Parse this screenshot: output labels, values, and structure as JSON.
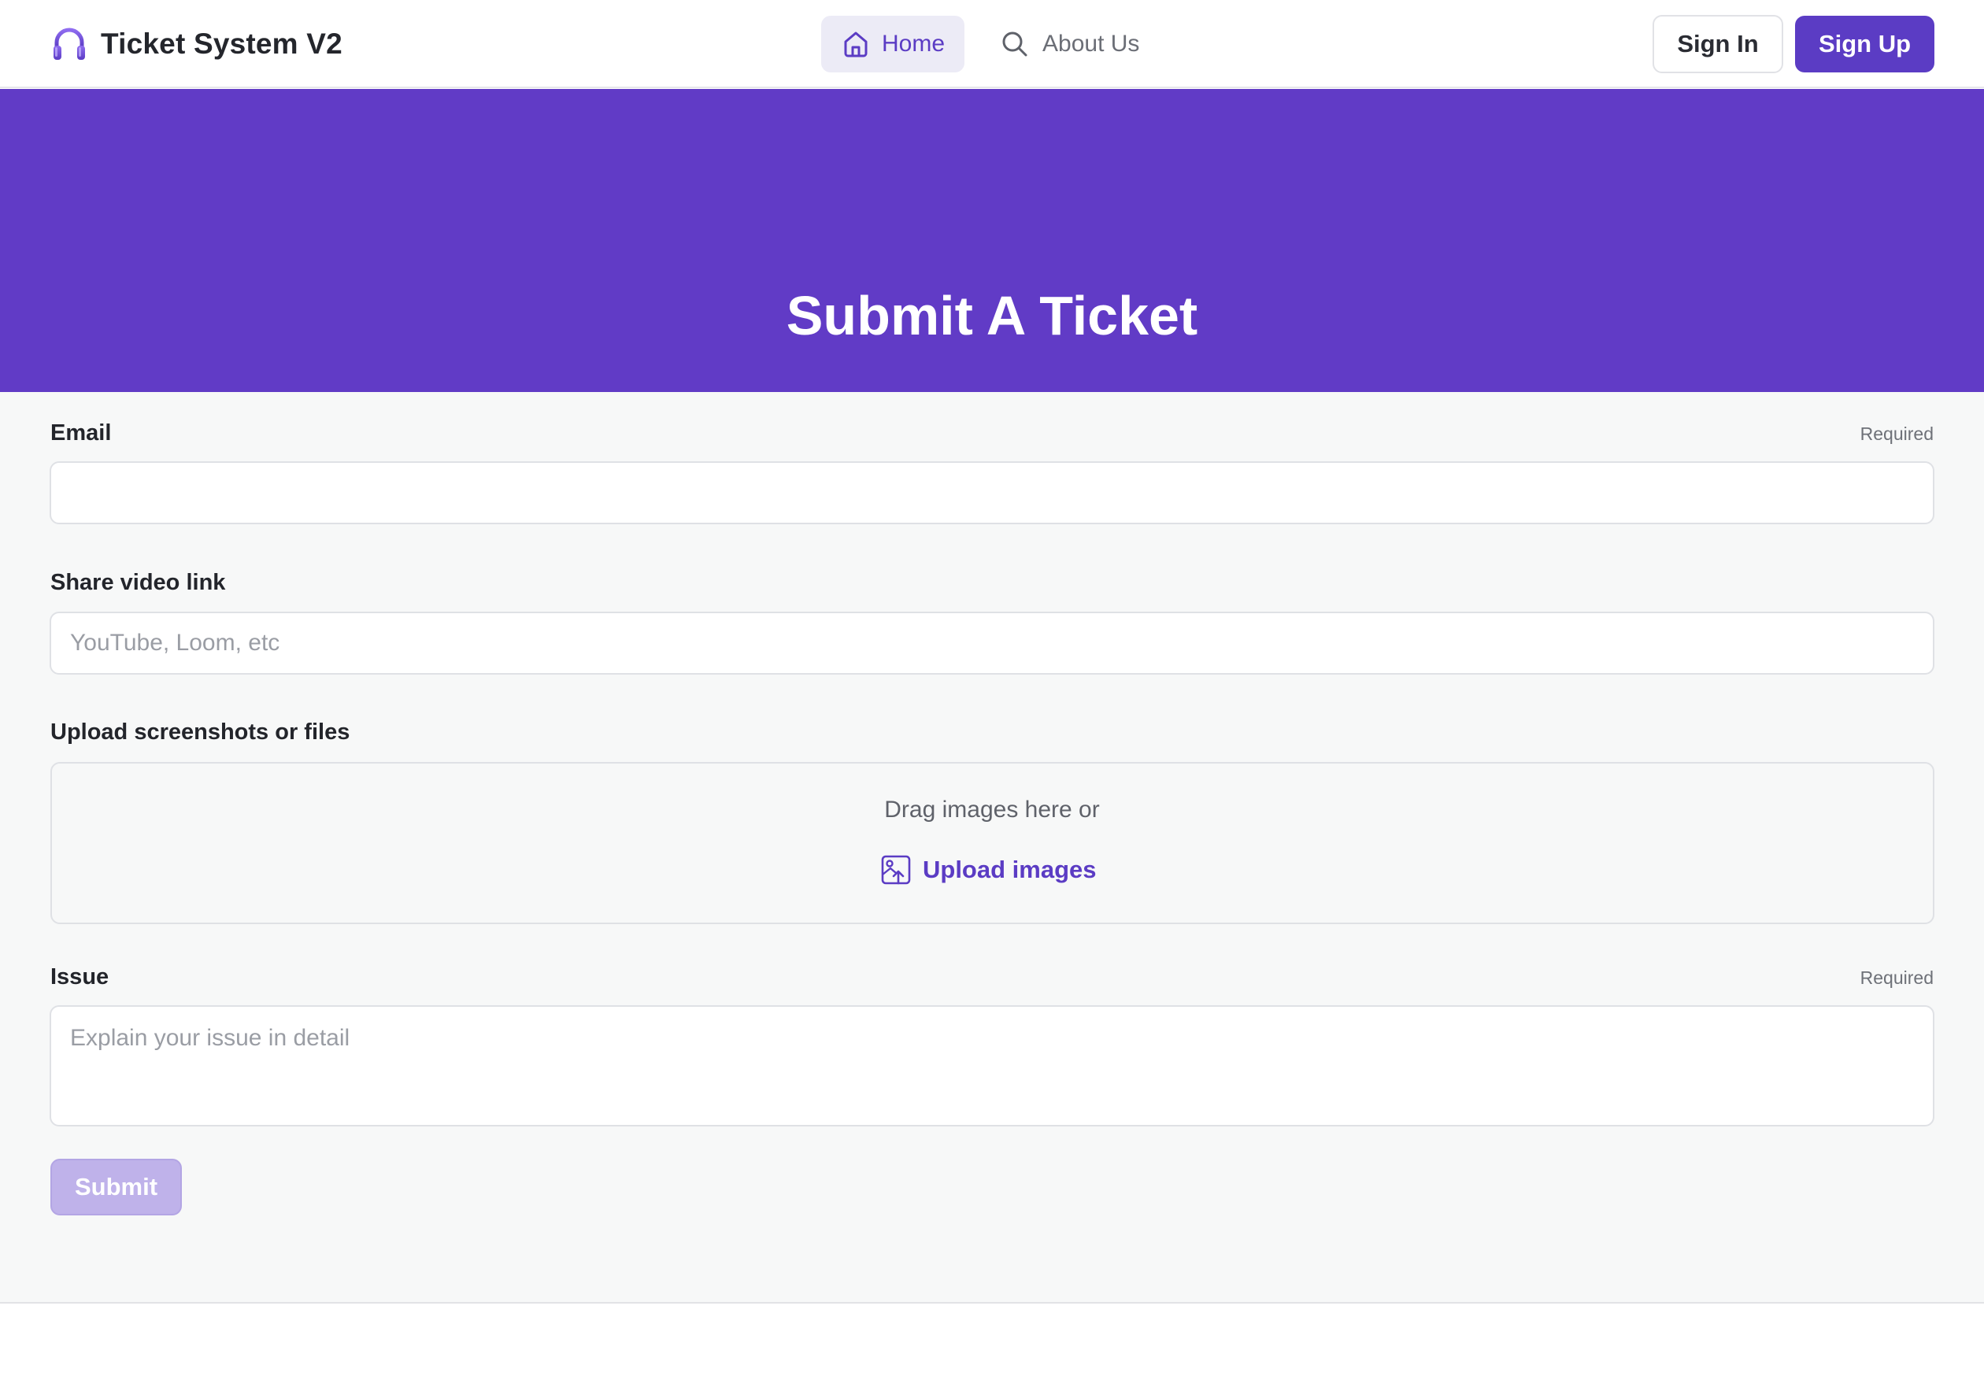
{
  "header": {
    "app_title": "Ticket System V2",
    "logo_icon": "headphones-icon",
    "nav": {
      "home_label": "Home",
      "home_icon": "home-icon",
      "about_label": "About Us",
      "about_icon": "search-icon"
    },
    "sign_in_label": "Sign In",
    "sign_up_label": "Sign Up"
  },
  "hero": {
    "title": "Submit A Ticket"
  },
  "form": {
    "email": {
      "label": "Email",
      "required_text": "Required",
      "value": "",
      "placeholder": ""
    },
    "video_link": {
      "label": "Share video link",
      "value": "",
      "placeholder": "YouTube, Loom, etc"
    },
    "upload": {
      "label": "Upload screenshots or files",
      "drag_text": "Drag images here or",
      "link_label": "Upload images",
      "icon": "image-upload-icon"
    },
    "issue": {
      "label": "Issue",
      "required_text": "Required",
      "value": "",
      "placeholder": "Explain your issue in detail"
    },
    "submit_label": "Submit"
  },
  "colors": {
    "brand": "#5b3cc4",
    "hero_background": "#613bc6",
    "page_background": "#f7f8f8",
    "submit_disabled": "#bfb2ea"
  }
}
